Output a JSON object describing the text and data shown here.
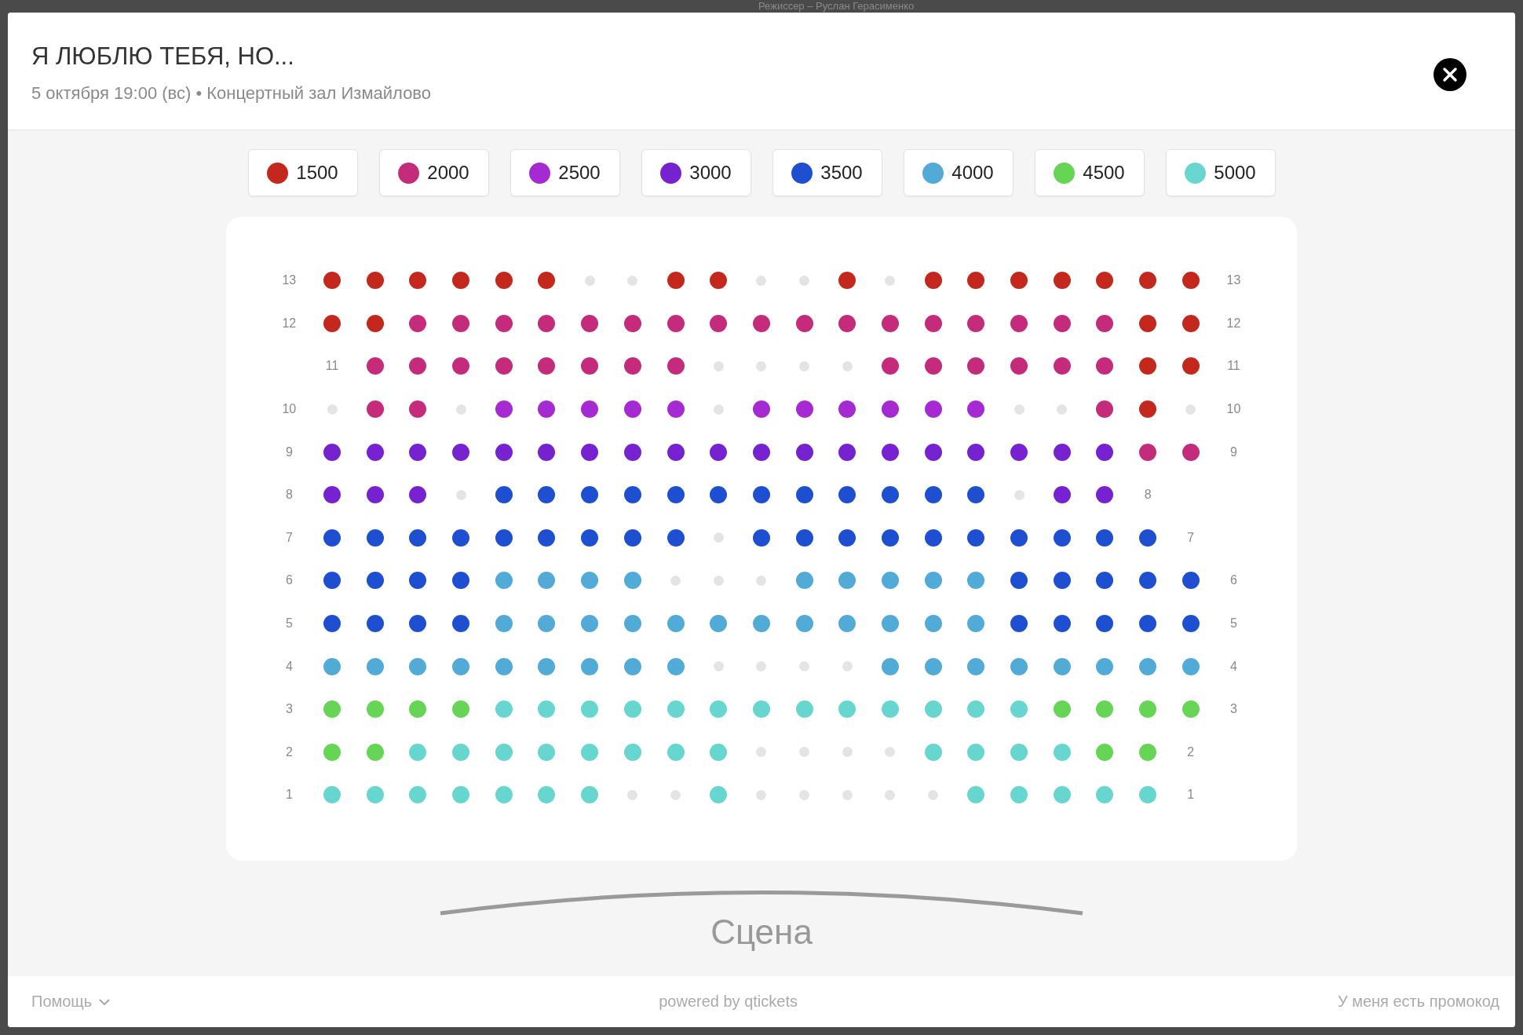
{
  "backdrop": {
    "text": "Режиссер – Руслан Герасименко"
  },
  "modal": {
    "title": "Я ЛЮБЛЮ ТЕБЯ, НО...",
    "subtitle": "5 октября 19:00 (вс) • Концертный зал Измайлово"
  },
  "legend": [
    {
      "price": "1500",
      "color": "#c4281c"
    },
    {
      "price": "2000",
      "color": "#c42b7a"
    },
    {
      "price": "2500",
      "color": "#a62ad1"
    },
    {
      "price": "3000",
      "color": "#7722d1"
    },
    {
      "price": "3500",
      "color": "#1f4fd1"
    },
    {
      "price": "4000",
      "color": "#52aad6"
    },
    {
      "price": "4500",
      "color": "#66d455"
    },
    {
      "price": "5000",
      "color": "#67d6cf"
    }
  ],
  "rows": [
    {
      "cells": [
        {
          "kind": "label",
          "text": "13"
        },
        {
          "kind": "seat",
          "color": "#c4281c"
        },
        {
          "kind": "seat",
          "color": "#c4281c"
        },
        {
          "kind": "seat",
          "color": "#c4281c"
        },
        {
          "kind": "seat",
          "color": "#c4281c"
        },
        {
          "kind": "seat",
          "color": "#c4281c"
        },
        {
          "kind": "seat",
          "color": "#c4281c"
        },
        {
          "kind": "taken"
        },
        {
          "kind": "taken"
        },
        {
          "kind": "seat",
          "color": "#c4281c"
        },
        {
          "kind": "seat",
          "color": "#c4281c"
        },
        {
          "kind": "taken"
        },
        {
          "kind": "taken"
        },
        {
          "kind": "seat",
          "color": "#c4281c"
        },
        {
          "kind": "taken"
        },
        {
          "kind": "seat",
          "color": "#c4281c"
        },
        {
          "kind": "seat",
          "color": "#c4281c"
        },
        {
          "kind": "seat",
          "color": "#c4281c"
        },
        {
          "kind": "seat",
          "color": "#c4281c"
        },
        {
          "kind": "seat",
          "color": "#c4281c"
        },
        {
          "kind": "seat",
          "color": "#c4281c"
        },
        {
          "kind": "seat",
          "color": "#c4281c"
        },
        {
          "kind": "label",
          "text": "13"
        }
      ]
    },
    {
      "cells": [
        {
          "kind": "label",
          "text": "12"
        },
        {
          "kind": "seat",
          "color": "#c4281c"
        },
        {
          "kind": "seat",
          "color": "#c4281c"
        },
        {
          "kind": "seat",
          "color": "#c42b7a"
        },
        {
          "kind": "seat",
          "color": "#c42b7a"
        },
        {
          "kind": "seat",
          "color": "#c42b7a"
        },
        {
          "kind": "seat",
          "color": "#c42b7a"
        },
        {
          "kind": "seat",
          "color": "#c42b7a"
        },
        {
          "kind": "seat",
          "color": "#c42b7a"
        },
        {
          "kind": "seat",
          "color": "#c42b7a"
        },
        {
          "kind": "seat",
          "color": "#c42b7a"
        },
        {
          "kind": "seat",
          "color": "#c42b7a"
        },
        {
          "kind": "seat",
          "color": "#c42b7a"
        },
        {
          "kind": "seat",
          "color": "#c42b7a"
        },
        {
          "kind": "seat",
          "color": "#c42b7a"
        },
        {
          "kind": "seat",
          "color": "#c42b7a"
        },
        {
          "kind": "seat",
          "color": "#c42b7a"
        },
        {
          "kind": "seat",
          "color": "#c42b7a"
        },
        {
          "kind": "seat",
          "color": "#c42b7a"
        },
        {
          "kind": "seat",
          "color": "#c42b7a"
        },
        {
          "kind": "seat",
          "color": "#c4281c"
        },
        {
          "kind": "seat",
          "color": "#c4281c"
        },
        {
          "kind": "label",
          "text": "12"
        }
      ]
    },
    {
      "cells": [
        {
          "kind": "gap"
        },
        {
          "kind": "label",
          "text": "11"
        },
        {
          "kind": "seat",
          "color": "#c42b7a"
        },
        {
          "kind": "seat",
          "color": "#c42b7a"
        },
        {
          "kind": "seat",
          "color": "#c42b7a"
        },
        {
          "kind": "seat",
          "color": "#c42b7a"
        },
        {
          "kind": "seat",
          "color": "#c42b7a"
        },
        {
          "kind": "seat",
          "color": "#c42b7a"
        },
        {
          "kind": "seat",
          "color": "#c42b7a"
        },
        {
          "kind": "seat",
          "color": "#c42b7a"
        },
        {
          "kind": "taken"
        },
        {
          "kind": "taken"
        },
        {
          "kind": "taken"
        },
        {
          "kind": "taken"
        },
        {
          "kind": "seat",
          "color": "#c42b7a"
        },
        {
          "kind": "seat",
          "color": "#c42b7a"
        },
        {
          "kind": "seat",
          "color": "#c42b7a"
        },
        {
          "kind": "seat",
          "color": "#c42b7a"
        },
        {
          "kind": "seat",
          "color": "#c42b7a"
        },
        {
          "kind": "seat",
          "color": "#c42b7a"
        },
        {
          "kind": "seat",
          "color": "#c4281c"
        },
        {
          "kind": "seat",
          "color": "#c4281c"
        },
        {
          "kind": "label",
          "text": "11"
        }
      ]
    },
    {
      "cells": [
        {
          "kind": "label",
          "text": "10"
        },
        {
          "kind": "taken"
        },
        {
          "kind": "seat",
          "color": "#c42b7a"
        },
        {
          "kind": "seat",
          "color": "#c42b7a"
        },
        {
          "kind": "taken"
        },
        {
          "kind": "seat",
          "color": "#a62ad1"
        },
        {
          "kind": "seat",
          "color": "#a62ad1"
        },
        {
          "kind": "seat",
          "color": "#a62ad1"
        },
        {
          "kind": "seat",
          "color": "#a62ad1"
        },
        {
          "kind": "seat",
          "color": "#a62ad1"
        },
        {
          "kind": "taken"
        },
        {
          "kind": "seat",
          "color": "#a62ad1"
        },
        {
          "kind": "seat",
          "color": "#a62ad1"
        },
        {
          "kind": "seat",
          "color": "#a62ad1"
        },
        {
          "kind": "seat",
          "color": "#a62ad1"
        },
        {
          "kind": "seat",
          "color": "#a62ad1"
        },
        {
          "kind": "seat",
          "color": "#a62ad1"
        },
        {
          "kind": "taken"
        },
        {
          "kind": "taken"
        },
        {
          "kind": "seat",
          "color": "#c42b7a"
        },
        {
          "kind": "seat",
          "color": "#c4281c"
        },
        {
          "kind": "taken"
        },
        {
          "kind": "label",
          "text": "10"
        }
      ]
    },
    {
      "cells": [
        {
          "kind": "label",
          "text": "9"
        },
        {
          "kind": "seat",
          "color": "#7722d1"
        },
        {
          "kind": "seat",
          "color": "#7722d1"
        },
        {
          "kind": "seat",
          "color": "#7722d1"
        },
        {
          "kind": "seat",
          "color": "#7722d1"
        },
        {
          "kind": "seat",
          "color": "#7722d1"
        },
        {
          "kind": "seat",
          "color": "#7722d1"
        },
        {
          "kind": "seat",
          "color": "#7722d1"
        },
        {
          "kind": "seat",
          "color": "#7722d1"
        },
        {
          "kind": "seat",
          "color": "#7722d1"
        },
        {
          "kind": "seat",
          "color": "#7722d1"
        },
        {
          "kind": "seat",
          "color": "#7722d1"
        },
        {
          "kind": "seat",
          "color": "#7722d1"
        },
        {
          "kind": "seat",
          "color": "#7722d1"
        },
        {
          "kind": "seat",
          "color": "#7722d1"
        },
        {
          "kind": "seat",
          "color": "#7722d1"
        },
        {
          "kind": "seat",
          "color": "#7722d1"
        },
        {
          "kind": "seat",
          "color": "#7722d1"
        },
        {
          "kind": "seat",
          "color": "#7722d1"
        },
        {
          "kind": "seat",
          "color": "#7722d1"
        },
        {
          "kind": "seat",
          "color": "#c42b7a"
        },
        {
          "kind": "seat",
          "color": "#c42b7a"
        },
        {
          "kind": "label",
          "text": "9"
        }
      ]
    },
    {
      "cells": [
        {
          "kind": "label",
          "text": "8"
        },
        {
          "kind": "seat",
          "color": "#7722d1"
        },
        {
          "kind": "seat",
          "color": "#7722d1"
        },
        {
          "kind": "seat",
          "color": "#7722d1"
        },
        {
          "kind": "taken"
        },
        {
          "kind": "seat",
          "color": "#1f4fd1"
        },
        {
          "kind": "seat",
          "color": "#1f4fd1"
        },
        {
          "kind": "seat",
          "color": "#1f4fd1"
        },
        {
          "kind": "seat",
          "color": "#1f4fd1"
        },
        {
          "kind": "seat",
          "color": "#1f4fd1"
        },
        {
          "kind": "seat",
          "color": "#1f4fd1"
        },
        {
          "kind": "seat",
          "color": "#1f4fd1"
        },
        {
          "kind": "seat",
          "color": "#1f4fd1"
        },
        {
          "kind": "seat",
          "color": "#1f4fd1"
        },
        {
          "kind": "seat",
          "color": "#1f4fd1"
        },
        {
          "kind": "seat",
          "color": "#1f4fd1"
        },
        {
          "kind": "seat",
          "color": "#1f4fd1"
        },
        {
          "kind": "taken"
        },
        {
          "kind": "seat",
          "color": "#7722d1"
        },
        {
          "kind": "seat",
          "color": "#7722d1"
        },
        {
          "kind": "label",
          "text": "8"
        },
        {
          "kind": "gap"
        },
        {
          "kind": "gap"
        }
      ]
    },
    {
      "cells": [
        {
          "kind": "label",
          "text": "7"
        },
        {
          "kind": "seat",
          "color": "#1f4fd1"
        },
        {
          "kind": "seat",
          "color": "#1f4fd1"
        },
        {
          "kind": "seat",
          "color": "#1f4fd1"
        },
        {
          "kind": "seat",
          "color": "#1f4fd1"
        },
        {
          "kind": "seat",
          "color": "#1f4fd1"
        },
        {
          "kind": "seat",
          "color": "#1f4fd1"
        },
        {
          "kind": "seat",
          "color": "#1f4fd1"
        },
        {
          "kind": "seat",
          "color": "#1f4fd1"
        },
        {
          "kind": "seat",
          "color": "#1f4fd1"
        },
        {
          "kind": "taken"
        },
        {
          "kind": "seat",
          "color": "#1f4fd1"
        },
        {
          "kind": "seat",
          "color": "#1f4fd1"
        },
        {
          "kind": "seat",
          "color": "#1f4fd1"
        },
        {
          "kind": "seat",
          "color": "#1f4fd1"
        },
        {
          "kind": "seat",
          "color": "#1f4fd1"
        },
        {
          "kind": "seat",
          "color": "#1f4fd1"
        },
        {
          "kind": "seat",
          "color": "#1f4fd1"
        },
        {
          "kind": "seat",
          "color": "#1f4fd1"
        },
        {
          "kind": "seat",
          "color": "#1f4fd1"
        },
        {
          "kind": "seat",
          "color": "#1f4fd1"
        },
        {
          "kind": "label",
          "text": "7"
        },
        {
          "kind": "gap"
        }
      ]
    },
    {
      "cells": [
        {
          "kind": "label",
          "text": "6"
        },
        {
          "kind": "seat",
          "color": "#1f4fd1"
        },
        {
          "kind": "seat",
          "color": "#1f4fd1"
        },
        {
          "kind": "seat",
          "color": "#1f4fd1"
        },
        {
          "kind": "seat",
          "color": "#1f4fd1"
        },
        {
          "kind": "seat",
          "color": "#52aad6"
        },
        {
          "kind": "seat",
          "color": "#52aad6"
        },
        {
          "kind": "seat",
          "color": "#52aad6"
        },
        {
          "kind": "seat",
          "color": "#52aad6"
        },
        {
          "kind": "taken"
        },
        {
          "kind": "taken"
        },
        {
          "kind": "taken"
        },
        {
          "kind": "seat",
          "color": "#52aad6"
        },
        {
          "kind": "seat",
          "color": "#52aad6"
        },
        {
          "kind": "seat",
          "color": "#52aad6"
        },
        {
          "kind": "seat",
          "color": "#52aad6"
        },
        {
          "kind": "seat",
          "color": "#52aad6"
        },
        {
          "kind": "seat",
          "color": "#1f4fd1"
        },
        {
          "kind": "seat",
          "color": "#1f4fd1"
        },
        {
          "kind": "seat",
          "color": "#1f4fd1"
        },
        {
          "kind": "seat",
          "color": "#1f4fd1"
        },
        {
          "kind": "seat",
          "color": "#1f4fd1"
        },
        {
          "kind": "label",
          "text": "6"
        }
      ]
    },
    {
      "cells": [
        {
          "kind": "label",
          "text": "5"
        },
        {
          "kind": "seat",
          "color": "#1f4fd1"
        },
        {
          "kind": "seat",
          "color": "#1f4fd1"
        },
        {
          "kind": "seat",
          "color": "#1f4fd1"
        },
        {
          "kind": "seat",
          "color": "#1f4fd1"
        },
        {
          "kind": "seat",
          "color": "#52aad6"
        },
        {
          "kind": "seat",
          "color": "#52aad6"
        },
        {
          "kind": "seat",
          "color": "#52aad6"
        },
        {
          "kind": "seat",
          "color": "#52aad6"
        },
        {
          "kind": "seat",
          "color": "#52aad6"
        },
        {
          "kind": "seat",
          "color": "#52aad6"
        },
        {
          "kind": "seat",
          "color": "#52aad6"
        },
        {
          "kind": "seat",
          "color": "#52aad6"
        },
        {
          "kind": "seat",
          "color": "#52aad6"
        },
        {
          "kind": "seat",
          "color": "#52aad6"
        },
        {
          "kind": "seat",
          "color": "#52aad6"
        },
        {
          "kind": "seat",
          "color": "#52aad6"
        },
        {
          "kind": "seat",
          "color": "#1f4fd1"
        },
        {
          "kind": "seat",
          "color": "#1f4fd1"
        },
        {
          "kind": "seat",
          "color": "#1f4fd1"
        },
        {
          "kind": "seat",
          "color": "#1f4fd1"
        },
        {
          "kind": "seat",
          "color": "#1f4fd1"
        },
        {
          "kind": "label",
          "text": "5"
        }
      ]
    },
    {
      "cells": [
        {
          "kind": "label",
          "text": "4"
        },
        {
          "kind": "seat",
          "color": "#52aad6"
        },
        {
          "kind": "seat",
          "color": "#52aad6"
        },
        {
          "kind": "seat",
          "color": "#52aad6"
        },
        {
          "kind": "seat",
          "color": "#52aad6"
        },
        {
          "kind": "seat",
          "color": "#52aad6"
        },
        {
          "kind": "seat",
          "color": "#52aad6"
        },
        {
          "kind": "seat",
          "color": "#52aad6"
        },
        {
          "kind": "seat",
          "color": "#52aad6"
        },
        {
          "kind": "seat",
          "color": "#52aad6"
        },
        {
          "kind": "taken"
        },
        {
          "kind": "taken"
        },
        {
          "kind": "taken"
        },
        {
          "kind": "taken"
        },
        {
          "kind": "seat",
          "color": "#52aad6"
        },
        {
          "kind": "seat",
          "color": "#52aad6"
        },
        {
          "kind": "seat",
          "color": "#52aad6"
        },
        {
          "kind": "seat",
          "color": "#52aad6"
        },
        {
          "kind": "seat",
          "color": "#52aad6"
        },
        {
          "kind": "seat",
          "color": "#52aad6"
        },
        {
          "kind": "seat",
          "color": "#52aad6"
        },
        {
          "kind": "seat",
          "color": "#52aad6"
        },
        {
          "kind": "label",
          "text": "4"
        }
      ]
    },
    {
      "cells": [
        {
          "kind": "label",
          "text": "3"
        },
        {
          "kind": "seat",
          "color": "#66d455"
        },
        {
          "kind": "seat",
          "color": "#66d455"
        },
        {
          "kind": "seat",
          "color": "#66d455"
        },
        {
          "kind": "seat",
          "color": "#66d455"
        },
        {
          "kind": "seat",
          "color": "#67d6cf"
        },
        {
          "kind": "seat",
          "color": "#67d6cf"
        },
        {
          "kind": "seat",
          "color": "#67d6cf"
        },
        {
          "kind": "seat",
          "color": "#67d6cf"
        },
        {
          "kind": "seat",
          "color": "#67d6cf"
        },
        {
          "kind": "seat",
          "color": "#67d6cf"
        },
        {
          "kind": "seat",
          "color": "#67d6cf"
        },
        {
          "kind": "seat",
          "color": "#67d6cf"
        },
        {
          "kind": "seat",
          "color": "#67d6cf"
        },
        {
          "kind": "seat",
          "color": "#67d6cf"
        },
        {
          "kind": "seat",
          "color": "#67d6cf"
        },
        {
          "kind": "seat",
          "color": "#67d6cf"
        },
        {
          "kind": "seat",
          "color": "#67d6cf"
        },
        {
          "kind": "seat",
          "color": "#66d455"
        },
        {
          "kind": "seat",
          "color": "#66d455"
        },
        {
          "kind": "seat",
          "color": "#66d455"
        },
        {
          "kind": "seat",
          "color": "#66d455"
        },
        {
          "kind": "label",
          "text": "3"
        }
      ]
    },
    {
      "cells": [
        {
          "kind": "label",
          "text": "2"
        },
        {
          "kind": "seat",
          "color": "#66d455"
        },
        {
          "kind": "seat",
          "color": "#66d455"
        },
        {
          "kind": "seat",
          "color": "#67d6cf"
        },
        {
          "kind": "seat",
          "color": "#67d6cf"
        },
        {
          "kind": "seat",
          "color": "#67d6cf"
        },
        {
          "kind": "seat",
          "color": "#67d6cf"
        },
        {
          "kind": "seat",
          "color": "#67d6cf"
        },
        {
          "kind": "seat",
          "color": "#67d6cf"
        },
        {
          "kind": "seat",
          "color": "#67d6cf"
        },
        {
          "kind": "seat",
          "color": "#67d6cf"
        },
        {
          "kind": "taken"
        },
        {
          "kind": "taken"
        },
        {
          "kind": "taken"
        },
        {
          "kind": "taken"
        },
        {
          "kind": "seat",
          "color": "#67d6cf"
        },
        {
          "kind": "seat",
          "color": "#67d6cf"
        },
        {
          "kind": "seat",
          "color": "#67d6cf"
        },
        {
          "kind": "seat",
          "color": "#67d6cf"
        },
        {
          "kind": "seat",
          "color": "#66d455"
        },
        {
          "kind": "seat",
          "color": "#66d455"
        },
        {
          "kind": "label",
          "text": "2"
        },
        {
          "kind": "gap"
        }
      ]
    },
    {
      "cells": [
        {
          "kind": "label",
          "text": "1"
        },
        {
          "kind": "seat",
          "color": "#67d6cf"
        },
        {
          "kind": "seat",
          "color": "#67d6cf"
        },
        {
          "kind": "seat",
          "color": "#67d6cf"
        },
        {
          "kind": "seat",
          "color": "#67d6cf"
        },
        {
          "kind": "seat",
          "color": "#67d6cf"
        },
        {
          "kind": "seat",
          "color": "#67d6cf"
        },
        {
          "kind": "seat",
          "color": "#67d6cf"
        },
        {
          "kind": "taken"
        },
        {
          "kind": "taken"
        },
        {
          "kind": "seat",
          "color": "#67d6cf"
        },
        {
          "kind": "taken"
        },
        {
          "kind": "taken"
        },
        {
          "kind": "taken"
        },
        {
          "kind": "taken"
        },
        {
          "kind": "taken"
        },
        {
          "kind": "seat",
          "color": "#67d6cf"
        },
        {
          "kind": "seat",
          "color": "#67d6cf"
        },
        {
          "kind": "seat",
          "color": "#67d6cf"
        },
        {
          "kind": "seat",
          "color": "#67d6cf"
        },
        {
          "kind": "seat",
          "color": "#67d6cf"
        },
        {
          "kind": "label",
          "text": "1"
        },
        {
          "kind": "gap"
        }
      ]
    }
  ],
  "stage": {
    "label": "Сцена"
  },
  "footer": {
    "help": "Помощь",
    "powered": "powered by qtickets",
    "promo": "У меня есть промокод"
  }
}
